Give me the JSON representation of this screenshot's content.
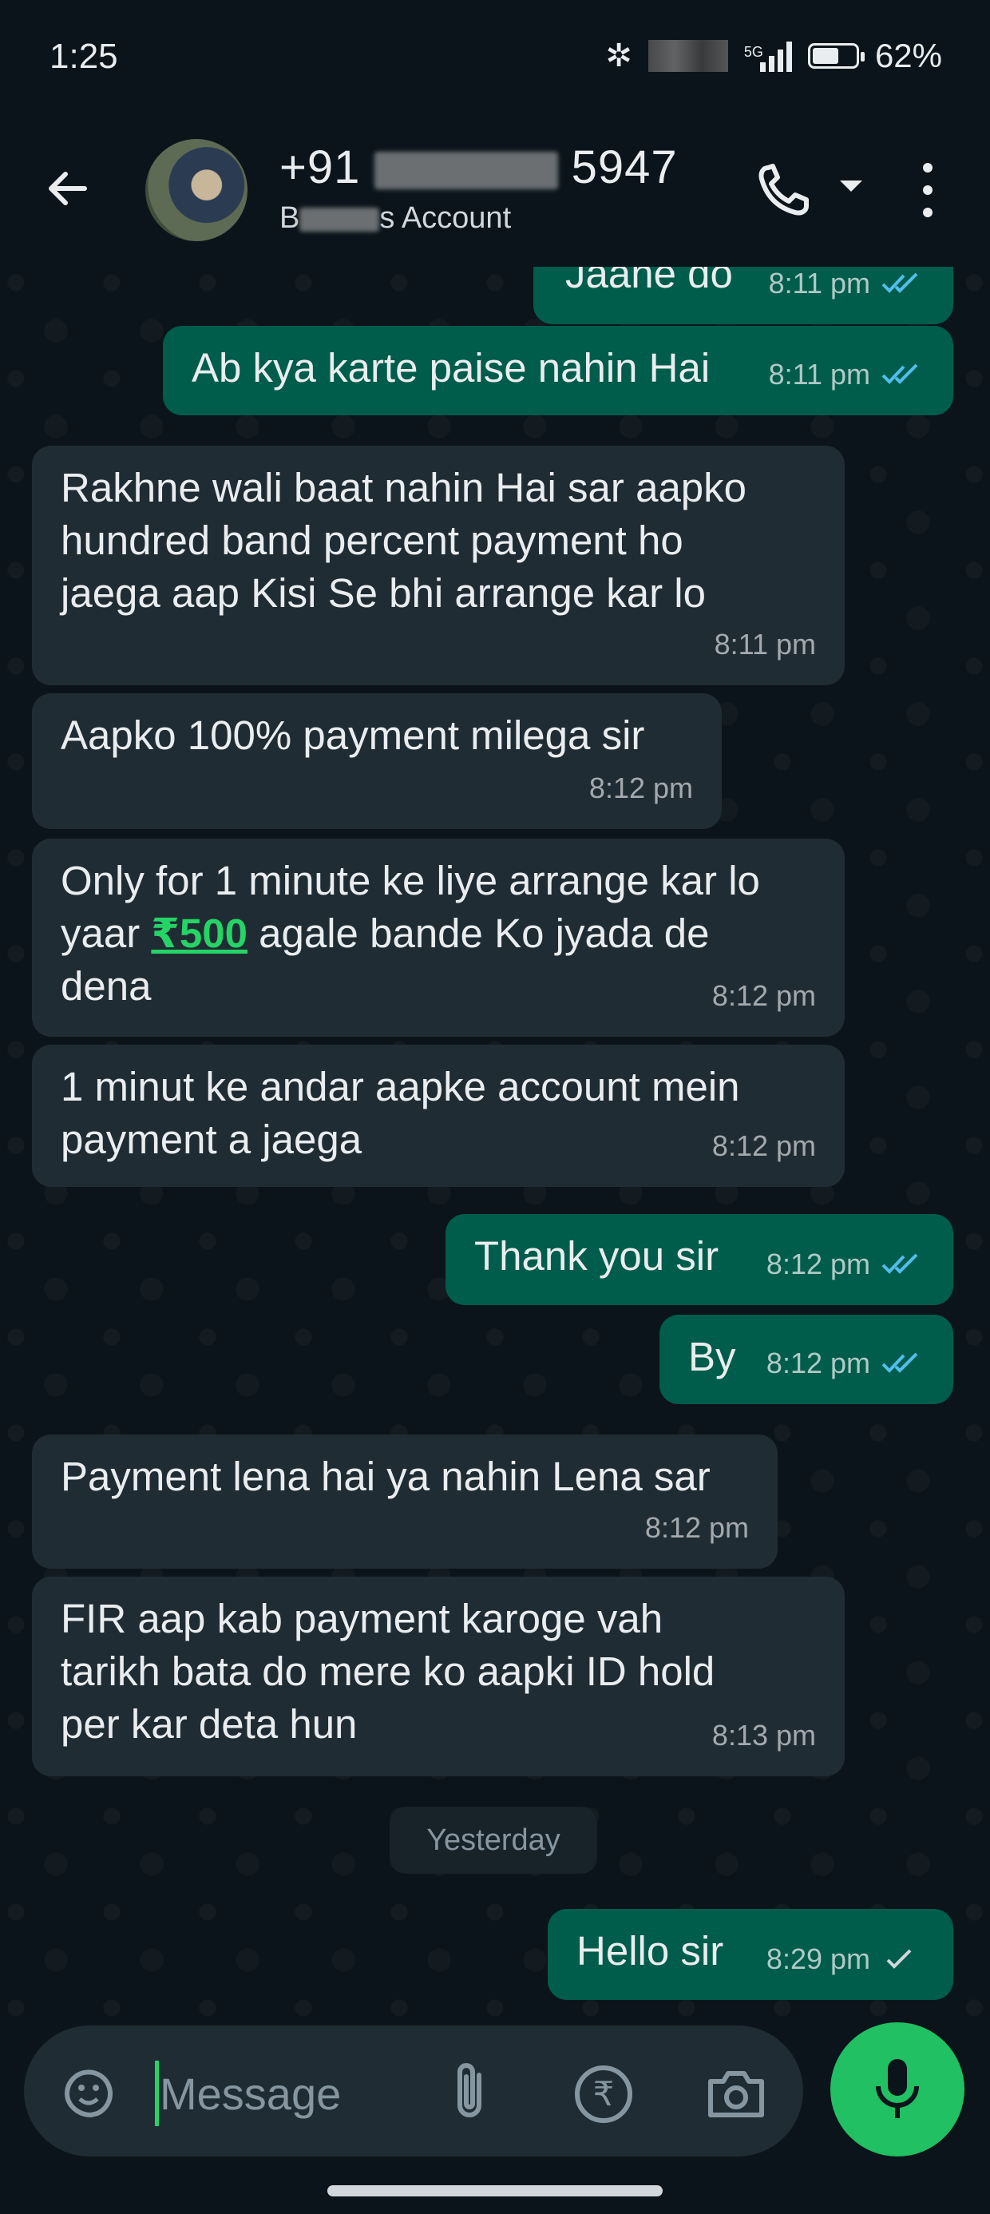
{
  "status_bar": {
    "time": "1:25",
    "network": "5G",
    "battery": "62%",
    "battery_level": 0.62
  },
  "header": {
    "contact_name_prefix": "+91",
    "contact_name_suffix": "5947",
    "subtitle_prefix": "B",
    "subtitle_suffix": "s Account",
    "icons": [
      "back-arrow-icon",
      "phone-icon",
      "dropdown-caret-icon",
      "more-vertical-icon"
    ]
  },
  "messages": [
    {
      "direction": "out",
      "text": "Jaane do",
      "time": "8:11 pm",
      "status": "read"
    },
    {
      "direction": "out",
      "text": "Ab kya karte paise nahin Hai",
      "time": "8:11 pm",
      "status": "read"
    },
    {
      "direction": "in",
      "lines": [
        "Rakhne wali baat nahin Hai sar aapko",
        "hundred band percent payment ho",
        "jaega aap Kisi Se bhi arrange kar lo"
      ],
      "time": "8:11 pm"
    },
    {
      "direction": "in",
      "text": "Aapko 100% payment milega sir",
      "time": "8:12 pm"
    },
    {
      "direction": "in",
      "line1": "Only for 1 minute ke liye arrange kar lo",
      "line2_pre": "yaar ",
      "amount": "₹500",
      "line2_post": " agale bande Ko jyada de",
      "line3": "dena",
      "time": "8:12 pm"
    },
    {
      "direction": "in",
      "lines": [
        "1 minut ke andar aapke account mein",
        "payment a jaega"
      ],
      "time": "8:12 pm"
    },
    {
      "direction": "out",
      "text": "Thank you sir",
      "time": "8:12 pm",
      "status": "read"
    },
    {
      "direction": "out",
      "text": "By",
      "time": "8:12 pm",
      "status": "read"
    },
    {
      "direction": "in",
      "text": "Payment lena hai ya nahin Lena sar",
      "time": "8:12 pm"
    },
    {
      "direction": "in",
      "lines": [
        "FIR aap kab payment karoge vah",
        "tarikh bata do mere ko aapki ID hold",
        "per kar deta hun"
      ],
      "time": "8:13 pm"
    },
    {
      "direction": "out",
      "text": "Hello sir",
      "time": "8:29 pm",
      "status": "sent"
    }
  ],
  "date_separator": "Yesterday",
  "composer": {
    "placeholder": "Message",
    "icons": [
      "sticker-icon",
      "attach-icon",
      "rupee-payment-icon",
      "camera-icon",
      "mic-icon"
    ]
  },
  "colors": {
    "background": "#0b141a",
    "incoming_bubble": "#202c33",
    "outgoing_bubble": "#005c4b",
    "read_ticks": "#53bdeb",
    "accent": "#25d366",
    "mic_button": "#21c063"
  }
}
